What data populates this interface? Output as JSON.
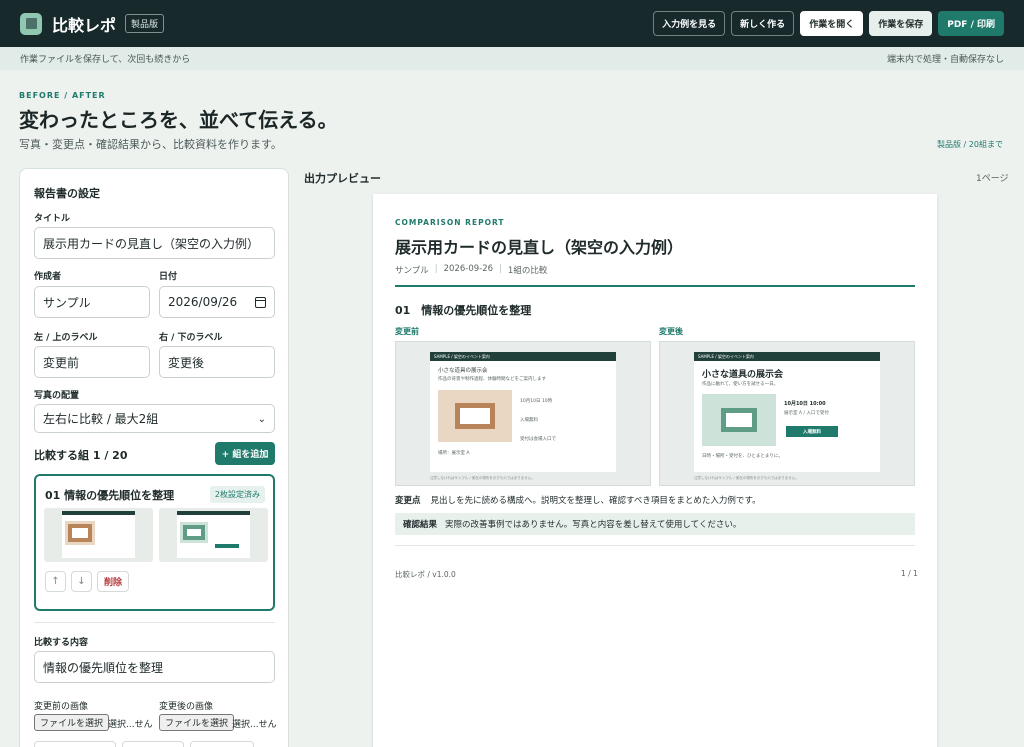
{
  "header": {
    "brand": "比較レポ",
    "edition_badge": "製品版",
    "buttons": [
      "入力例を見る",
      "新しく作る",
      "作業を開く",
      "作業を保存",
      "PDF / 印刷"
    ]
  },
  "subbar": {
    "left": "作業ファイルを保存して、次回も続きから",
    "right": "端末内で処理・自動保存なし"
  },
  "hero": {
    "eyebrow": "BEFORE / AFTER",
    "title": "変わったところを、並べて伝える。",
    "subtitle": "写真・変更点・確認結果から、比較資料を作ります。",
    "plan_note": "製品版 / 20組まで"
  },
  "settings": {
    "title": "報告書の設定",
    "title_label": "タイトル",
    "title_value": "展示用カードの見直し（架空の入力例）",
    "author_label": "作成者",
    "author_value": "サンプル",
    "date_label": "日付",
    "date_value": "2026/09/26",
    "left_label_label": "左 / 上のラベル",
    "left_label_value": "変更前",
    "right_label_label": "右 / 下のラベル",
    "right_label_value": "変更後",
    "layout_label": "写真の配置",
    "layout_value": "左右に比較 / 最大2組",
    "groups_heading": "比較する組 1 / 20",
    "add_group": "+ 組を追加",
    "group": {
      "title": "01 情報の優先順位を整理",
      "badge": "2枚設定済み",
      "up": "↑",
      "down": "↓",
      "delete": "削除"
    },
    "content_label": "比較する内容",
    "content_value": "情報の優先順位を整理",
    "before_image_label": "変更前の画像",
    "after_image_label": "変更後の画像",
    "file_button": "ファイルを選択",
    "file_none": "選択...せん"
  },
  "preview": {
    "title": "出力プレビュー",
    "page_count": "1ページ",
    "report": {
      "eyebrow": "COMPARISON REPORT",
      "title": "展示用カードの見直し（架空の入力例）",
      "meta_author": "サンプル",
      "meta_date": "2026-09-26",
      "meta_count": "1組の比較",
      "section_title": "01　情報の優先順位を整理",
      "before_label": "変更前",
      "after_label": "変更後",
      "before_shot": {
        "header": "SAMPLE / 架空のイベント案内",
        "line1": "小さな道具の展示会",
        "line2": "作品の背景や制作過程、体験時間などをご案内します",
        "detail1": "10月10日 10時",
        "detail2": "入場無料",
        "detail3": "受付は会場入口で",
        "place": "場所：展示室 A",
        "foot": "注意しなければサンプル / 実在の場所を示すものではありません。"
      },
      "after_shot": {
        "header": "SAMPLE / 架空のイベント案内",
        "title": "小さな道具の展示会",
        "sub": "作品に触れて、使い方を試せる一日。",
        "date": "10月10日 10:00",
        "place": "展示室 A / 入口で受付",
        "pill": "入場無料",
        "bottom": "日時・場所・受付を、ひとまとまりに。",
        "foot": "注意しなければサンプル / 実在の場所を示すものではありません。"
      },
      "change_label": "変更点",
      "change_text": "見出しを先に読める構成へ。説明文を整理し、確認すべき項目をまとめた入力例です。",
      "confirm_label": "確認結果",
      "confirm_text": "実際の改善事例ではありません。写真と内容を差し替えて使用してください。",
      "footer_left": "比較レポ / v1.0.0",
      "footer_right": "1 / 1"
    }
  },
  "colors": {
    "header_bg": "#17292b",
    "accent": "#1f7a6b",
    "page_bg": "#eef2ef",
    "before_frame": "#b8845a",
    "after_frame": "#5e9c86"
  }
}
